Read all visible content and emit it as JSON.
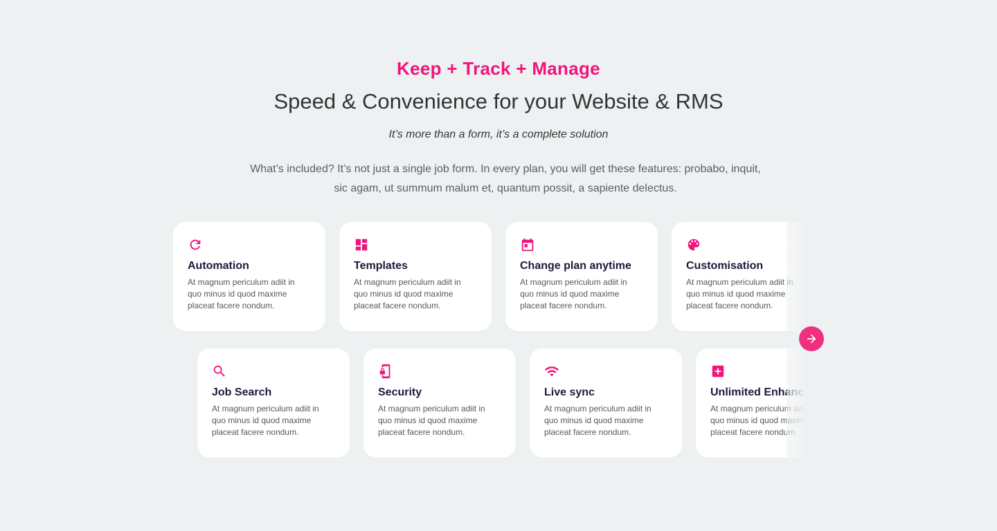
{
  "section": {
    "eyebrow": "Keep + Track + Manage",
    "headline": "Speed & Convenience for your Website & RMS",
    "tagline": "It’s more than a form, it’s a complete solution",
    "intro": "What’s included? It’s not just a single job form. In every plan, you will get these features: probabo, inquit, sic agam, ut summum malum et, quantum possit, a sapiente delectus."
  },
  "colors": {
    "accent": "#f0147c",
    "title": "#1a1a3a",
    "body": "#55575c",
    "background": "#eef1f2"
  },
  "features": [
    {
      "icon": "refresh-icon",
      "title": "Automation",
      "desc": "At magnum periculum adiit in quo minus id quod maxime placeat facere nondum."
    },
    {
      "icon": "dashboard-icon",
      "title": "Templates",
      "desc": "At magnum periculum adiit in quo minus id quod maxime placeat facere nondum."
    },
    {
      "icon": "calendar-icon",
      "title": "Change plan anytime",
      "desc": "At magnum periculum adiit in quo minus id quod maxime placeat facere nondum."
    },
    {
      "icon": "palette-icon",
      "title": "Customisation",
      "desc": "At magnum periculum adiit in quo minus id quod maxime placeat facere nondum."
    },
    {
      "icon": "search-icon",
      "title": "Job Search",
      "desc": "At magnum periculum adiit in quo minus id quod maxime placeat facere nondum."
    },
    {
      "icon": "phone-lock-icon",
      "title": "Security",
      "desc": "At magnum periculum adiit in quo minus id quod maxime placeat facere nondum."
    },
    {
      "icon": "wifi-icon",
      "title": "Live sync",
      "desc": "At magnum periculum adiit in quo minus id quod maxime placeat facere nondum."
    },
    {
      "icon": "plus-box-icon",
      "title": "Unlimited Enhancements",
      "desc": "At magnum periculum adiit in quo minus id quod maxime placeat facere nondum."
    }
  ],
  "carousel": {
    "next_icon": "arrow-right-icon"
  }
}
